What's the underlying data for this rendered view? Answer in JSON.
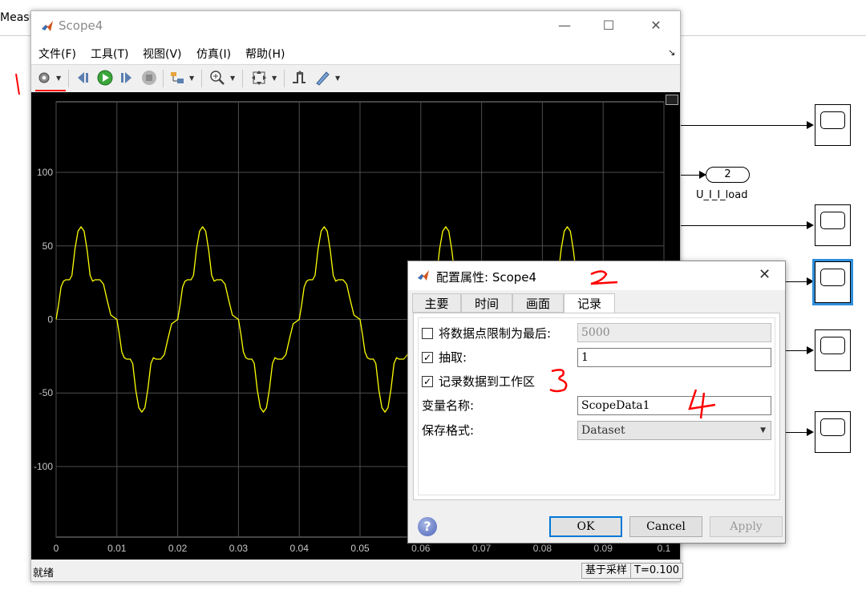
{
  "background": {
    "partial_title": "Measu",
    "outport": {
      "number": "2",
      "label": "U_I_I_load"
    }
  },
  "scope_window": {
    "title": "Scope4",
    "menu": [
      "文件(F)",
      "工具(T)",
      "视图(V)",
      "仿真(I)",
      "帮助(H)"
    ],
    "toolbar_icons": [
      "gear-icon",
      "step-back-icon",
      "run-icon",
      "step-forward-icon",
      "stop-icon",
      "highlight-block-icon",
      "zoom-icon",
      "fit-to-view-icon",
      "triggers-icon",
      "cursor-measure-icon"
    ],
    "status": {
      "left": "就绪",
      "mode": "基于采样",
      "time": "T=0.100"
    }
  },
  "chart_data": {
    "type": "line",
    "x_ticks": [
      "0",
      "0.01",
      "0.02",
      "0.03",
      "0.04",
      "0.05",
      "0.06",
      "0.07",
      "0.08",
      "0.09",
      "0.1"
    ],
    "y_ticks": [
      "100",
      "50",
      "0",
      "-50",
      "-100"
    ],
    "xlim": [
      0,
      0.1
    ],
    "ylim": [
      -148,
      148
    ],
    "grid": true,
    "background": "#000000",
    "line_color": "#ffff00",
    "frequency_hz": 50,
    "peak": 63,
    "shoulder": 26,
    "series": [
      {
        "values_period": [
          [
            0.0,
            0
          ],
          [
            0.0004,
            10
          ],
          [
            0.0008,
            22
          ],
          [
            0.0012,
            26
          ],
          [
            0.0016,
            27
          ],
          [
            0.0022,
            27
          ],
          [
            0.0026,
            30
          ],
          [
            0.0031,
            48
          ],
          [
            0.0036,
            60
          ],
          [
            0.0041,
            63
          ],
          [
            0.0046,
            60
          ],
          [
            0.0051,
            47
          ],
          [
            0.0056,
            30
          ],
          [
            0.006,
            26
          ],
          [
            0.0064,
            27
          ],
          [
            0.0072,
            27
          ],
          [
            0.0078,
            24
          ],
          [
            0.0084,
            13
          ],
          [
            0.009,
            3
          ],
          [
            0.01,
            0
          ],
          [
            0.0104,
            -10
          ],
          [
            0.0108,
            -22
          ],
          [
            0.0112,
            -26
          ],
          [
            0.0116,
            -27
          ],
          [
            0.0122,
            -27
          ],
          [
            0.0126,
            -30
          ],
          [
            0.0131,
            -48
          ],
          [
            0.0136,
            -60
          ],
          [
            0.0141,
            -63
          ],
          [
            0.0146,
            -60
          ],
          [
            0.0151,
            -47
          ],
          [
            0.0156,
            -30
          ],
          [
            0.016,
            -26
          ],
          [
            0.0164,
            -27
          ],
          [
            0.0172,
            -27
          ],
          [
            0.0178,
            -24
          ],
          [
            0.0184,
            -13
          ],
          [
            0.019,
            -3
          ],
          [
            0.02,
            0
          ]
        ]
      }
    ]
  },
  "dialog": {
    "title": "配置属性: Scope4",
    "tabs": [
      "主要",
      "时间",
      "画面",
      "记录"
    ],
    "active_tab": "记录",
    "rows": {
      "limit_label": "将数据点限制为最后:",
      "limit_value": "5000",
      "limit_checked": false,
      "decimation_label": "抽取:",
      "decimation_value": "1",
      "decimation_checked": true,
      "log_label": "记录数据到工作区",
      "log_checked": true,
      "varname_label": "变量名称:",
      "varname_value": "ScopeData1",
      "format_label": "保存格式:",
      "format_value": "Dataset"
    },
    "buttons": {
      "ok": "OK",
      "cancel": "Cancel",
      "apply": "Apply"
    }
  },
  "annotations": [
    "1",
    "2",
    "3",
    "4"
  ],
  "colors": {
    "annotation": "#ff0000",
    "accent": "#0078d7",
    "selection": "#2f8fdc"
  }
}
